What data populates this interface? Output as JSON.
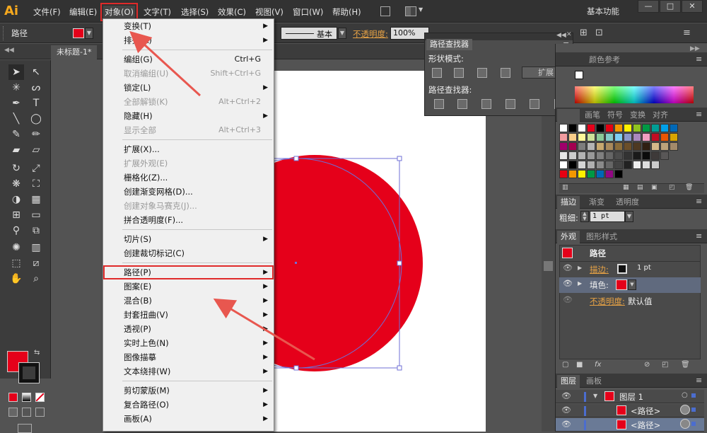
{
  "app": {
    "logo": "Ai"
  },
  "menubar": {
    "items": [
      "文件(F)",
      "编辑(E)",
      "对象(O)",
      "文字(T)",
      "选择(S)",
      "效果(C)",
      "视图(V)",
      "窗口(W)",
      "帮助(H)"
    ],
    "workspace": "基本功能"
  },
  "controlbar": {
    "selection": "路径",
    "stroke_style": "基本",
    "opacity_label": "不透明度:",
    "opacity_value": "100%"
  },
  "document": {
    "tab": "未标题-1*"
  },
  "object_menu": {
    "items": [
      {
        "label": "变换(T)",
        "submenu": true
      },
      {
        "label": "排列(A)",
        "submenu": true
      },
      {
        "sep": true
      },
      {
        "label": "编组(G)",
        "shortcut": "Ctrl+G"
      },
      {
        "label": "取消编组(U)",
        "shortcut": "Shift+Ctrl+G",
        "disabled": true
      },
      {
        "label": "锁定(L)",
        "submenu": true
      },
      {
        "label": "全部解锁(K)",
        "shortcut": "Alt+Ctrl+2",
        "disabled": true
      },
      {
        "label": "隐藏(H)",
        "submenu": true
      },
      {
        "label": "显示全部",
        "shortcut": "Alt+Ctrl+3",
        "disabled": true
      },
      {
        "sep": true
      },
      {
        "label": "扩展(X)..."
      },
      {
        "label": "扩展外观(E)",
        "disabled": true
      },
      {
        "label": "栅格化(Z)..."
      },
      {
        "label": "创建渐变网格(D)..."
      },
      {
        "label": "创建对象马赛克(J)...",
        "disabled": true
      },
      {
        "label": "拼合透明度(F)..."
      },
      {
        "sep": true
      },
      {
        "label": "切片(S)",
        "submenu": true
      },
      {
        "label": "创建裁切标记(C)"
      },
      {
        "sep": true
      },
      {
        "label": "路径(P)",
        "submenu": true,
        "highlight": true
      },
      {
        "label": "图案(E)",
        "submenu": true
      },
      {
        "label": "混合(B)",
        "submenu": true
      },
      {
        "label": "封套扭曲(V)",
        "submenu": true
      },
      {
        "label": "透视(P)",
        "submenu": true
      },
      {
        "label": "实时上色(N)",
        "submenu": true
      },
      {
        "label": "图像描摹",
        "submenu": true
      },
      {
        "label": "文本绕排(W)",
        "submenu": true
      },
      {
        "sep": true
      },
      {
        "label": "剪切蒙版(M)",
        "submenu": true
      },
      {
        "label": "复合路径(O)",
        "submenu": true
      },
      {
        "label": "画板(A)",
        "submenu": true
      }
    ]
  },
  "pathfinder": {
    "title": "路径查找器",
    "shape_modes": "形状模式:",
    "expand": "扩展",
    "pathfinders": "路径查找器:"
  },
  "color_panel": {
    "tabs": [
      "颜色参考"
    ]
  },
  "swatches_panel": {
    "tabs": [
      "画笔",
      "符号",
      "变换",
      "对齐"
    ]
  },
  "stroke_panel": {
    "tabs": [
      "描边",
      "渐变",
      "透明度"
    ],
    "weight_label": "粗细:",
    "weight_value": "1 pt"
  },
  "appearance_panel": {
    "tabs": [
      "外观",
      "图形样式"
    ],
    "object": "路径",
    "stroke_label": "描边:",
    "stroke_value": "1 pt",
    "fill_label": "填色:",
    "opacity_label": "不透明度:",
    "opacity_value": "默认值"
  },
  "layers_panel": {
    "tabs": [
      "图层",
      "画板"
    ],
    "layer": "图层 1",
    "items": [
      "<路径>",
      "<路径>"
    ]
  },
  "colors": {
    "accent_red": "#e5001a",
    "annotation_red": "#e02a2a",
    "menubar_bg": "#323232",
    "menu_bg": "#f0f0f0"
  }
}
